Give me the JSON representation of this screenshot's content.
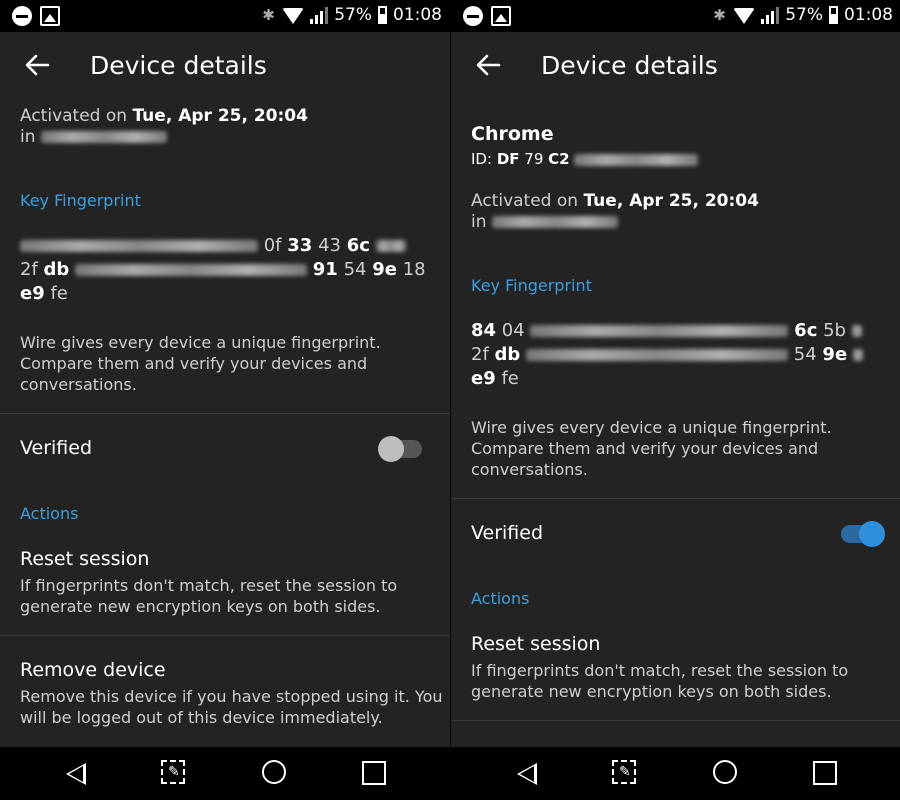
{
  "status_bar": {
    "battery": "57%",
    "time": "01:08"
  },
  "left": {
    "title": "Device details",
    "activated_prefix": "Activated on",
    "activated_date": "Tue, Apr 25, 20:04",
    "in_label": "in",
    "section_fingerprint": "Key Fingerprint",
    "fp_line1_tail_a": "0f",
    "fp_line1_b1": "33",
    "fp_line1_b2": "43",
    "fp_line1_b3": "6c",
    "fp_line2_a": "2f",
    "fp_line2_b": "db",
    "fp_line2_tail_a": "91",
    "fp_line2_tail_b": "54",
    "fp_line2_tail_c": "9e",
    "fp_line2_tail_d": "18",
    "fp_line3_a": "e9",
    "fp_line3_b": "fe",
    "info_text_1": "Wire gives every device a unique fingerprint.",
    "info_text_2": "Compare them and verify your devices and",
    "info_text_3": "conversations.",
    "verified_label": "Verified",
    "verified": false,
    "actions_label": "Actions",
    "reset_title": "Reset session",
    "reset_desc_1": "If fingerprints don't match, reset the session to",
    "reset_desc_2": "generate new encryption keys on both sides.",
    "remove_title": "Remove device",
    "remove_desc_1": "Remove this device if you have stopped using it. You",
    "remove_desc_2": "will be logged out of this device immediately."
  },
  "right": {
    "title": "Device details",
    "device_name": "Chrome",
    "id_prefix": "ID:",
    "id_a": "DF",
    "id_b": "79",
    "id_c": "C2",
    "activated_prefix": "Activated on",
    "activated_date": "Tue, Apr 25, 20:04",
    "in_label": "in",
    "section_fingerprint": "Key Fingerprint",
    "fp_line1_a": "84",
    "fp_line1_b": "04",
    "fp_line1_tail_a": "6c",
    "fp_line1_tail_b": "5b",
    "fp_line2_a": "2f",
    "fp_line2_b": "db",
    "fp_line2_tail_a": "54",
    "fp_line2_tail_b": "9e",
    "fp_line3_a": "e9",
    "fp_line3_b": "fe",
    "info_text_1": "Wire gives every device a unique fingerprint.",
    "info_text_2": "Compare them and verify your devices and",
    "info_text_3": "conversations.",
    "verified_label": "Verified",
    "verified": true,
    "actions_label": "Actions",
    "reset_title": "Reset session",
    "reset_desc_1": "If fingerprints don't match, reset the session to",
    "reset_desc_2": "generate new encryption keys on both sides."
  },
  "colors": {
    "accent": "#3b9fe0",
    "toggle_on_track": "#2a6aa0",
    "toggle_off_knob": "#bdbdbd"
  }
}
